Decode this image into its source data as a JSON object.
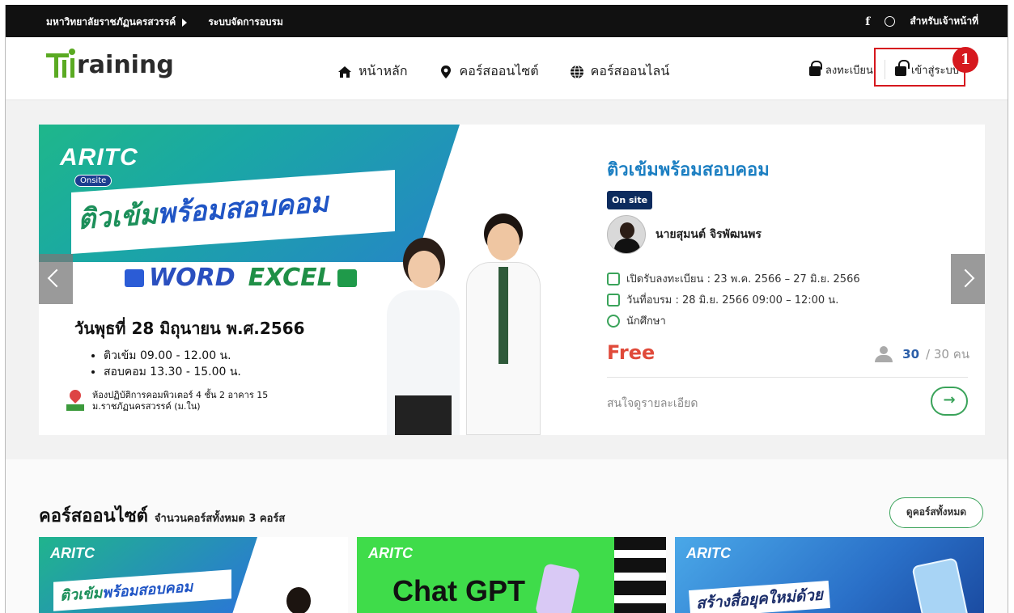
{
  "topbar": {
    "university": "มหาวิทยาลัยราชภัฏนครสวรรค์",
    "system": "ระบบจัดการอบรม",
    "facebook_glyph": "f",
    "staff_link": "สำหรับเจ้าหน้าที่"
  },
  "header": {
    "logo_suffix": "raining",
    "nav": [
      {
        "label": "หน้าหลัก",
        "icon": "home-icon"
      },
      {
        "label": "คอร์สออนไซต์",
        "icon": "map-pin-icon"
      },
      {
        "label": "คอร์สออนไลน์",
        "icon": "globe-icon"
      }
    ],
    "register_label": "ลงทะเบียน",
    "login_label": "เข้าสู่ระบบ",
    "annotation_number": "1",
    "annotation_color": "#d6181e"
  },
  "hero": {
    "banner": {
      "brand": "ARITC",
      "brand_tag": "Onsite",
      "title_part1": "ติวเข้ม",
      "title_part2": "พร้อมสอบคอม",
      "word": "WORD",
      "excel": "EXCEL",
      "date": "วันพุธที่ 28 มิถุนายน พ.ศ.2566",
      "schedule": [
        "ติวเข้ม    09.00 - 12.00 น.",
        "สอบคอม  13.30 - 15.00 น."
      ],
      "location_line1": "ห้องปฏิบัติการคอมพิวเตอร์ 4 ชั้น 2 อาคาร 15",
      "location_line2": "ม.ราชภัฏนครสวรรค์ (ม.ใน)"
    },
    "course_title": "ติวเข้มพร้อมสอบคอม",
    "badge": "On site",
    "instructor": "นายสุมนต์ จิรพัฒนพร",
    "register_period": "เปิดรับลงทะเบียน : 23 พ.ค. 2566 – 27 มิ.ย. 2566",
    "training_date": "วันที่อบรม : 28 มิ.ย. 2566 09:00 – 12:00 น.",
    "audience": "นักศึกษา",
    "price": "Free",
    "seats_taken": "30",
    "seats_total": "/ 30 คน",
    "details_label": "สนใจดูรายละเอียด",
    "go_glyph": "→",
    "accent_color": "#1c7fc2",
    "price_color": "#e04a3a"
  },
  "onsite_section": {
    "title": "คอร์สออนไซต์",
    "count_text": "จำนวนคอร์สทั้งหมด 3 คอร์ส",
    "see_all": "ดูคอร์สทั้งหมด",
    "cards": [
      {
        "brand": "ARITC",
        "title_part1": "ติวเข้ม",
        "title_part2": "พร้อมสอบคอม"
      },
      {
        "brand": "ARITC",
        "title": "Chat GPT"
      },
      {
        "brand": "ARITC",
        "title": "สร้างสื่อยุคใหม่ด้วย"
      }
    ]
  }
}
